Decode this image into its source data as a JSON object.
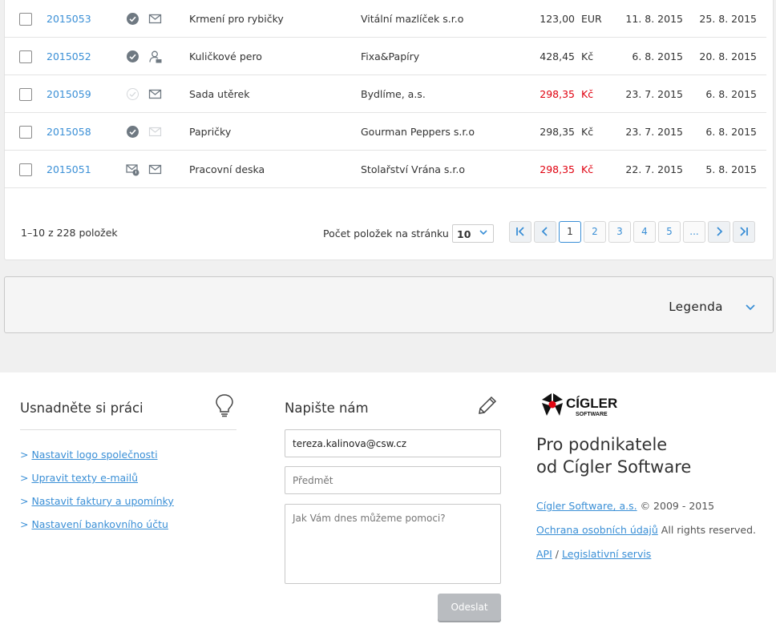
{
  "invoices": [
    {
      "number": "2015053",
      "status": "paid",
      "delivery": "email",
      "item": "Krmení pro rybičky",
      "company": "Vitální mazlíček s.r.o",
      "amount": "123,00",
      "currency": "EUR",
      "overdue": false,
      "issued": "11. 8. 2015",
      "due": "25. 8. 2015"
    },
    {
      "number": "2015052",
      "status": "paid",
      "delivery": "person",
      "item": "Kuličkové pero",
      "company": "Fixa&Papíry",
      "amount": "428,45",
      "currency": "Kč",
      "overdue": false,
      "issued": "6. 8. 2015",
      "due": "20. 8. 2015"
    },
    {
      "number": "2015059",
      "status": "unpaid",
      "delivery": "email",
      "item": "Sada utěrek",
      "company": "Bydlíme, a.s.",
      "amount": "298,35",
      "currency": "Kč",
      "overdue": true,
      "issued": "23. 7. 2015",
      "due": "6. 8. 2015"
    },
    {
      "number": "2015058",
      "status": "paid",
      "delivery": "email-pending",
      "item": "Papričky",
      "company": "Gourman Peppers s.r.o",
      "amount": "298,35",
      "currency": "Kč",
      "overdue": false,
      "issued": "23. 7. 2015",
      "due": "6. 8. 2015"
    },
    {
      "number": "2015051",
      "status": "reminder",
      "delivery": "email",
      "item": "Pracovní deska",
      "company": "Stolařství Vrána s.r.o",
      "amount": "298,35",
      "currency": "Kč",
      "overdue": true,
      "issued": "22. 7. 2015",
      "due": "5. 8. 2015"
    }
  ],
  "pagination": {
    "info": "1–10 z 228 položek",
    "per_page_label": "Počet položek na stránku",
    "per_page_value": "10",
    "pages": [
      "1",
      "2",
      "3",
      "4",
      "5",
      "..."
    ],
    "current_page": "1"
  },
  "legend": {
    "label": "Legenda"
  },
  "footer": {
    "help": {
      "title": "Usnadněte si práci",
      "links": [
        "Nastavit logo společnosti",
        "Upravit texty e-mailů",
        "Nastavit faktury a upomínky",
        "Nastavení bankovního účtu"
      ]
    },
    "contact": {
      "title": "Napište nám",
      "email_value": "tereza.kalinova@csw.cz",
      "subject_placeholder": "Předmět",
      "message_placeholder": "Jak Vám dnes můžeme pomoci?",
      "send_label": "Odeslat"
    },
    "brand": {
      "logo_text": "CÍGLER",
      "logo_sub": "SOFTWARE",
      "claim_line1": "Pro podnikatele",
      "claim_line2": "od Cígler Software",
      "company_link": "Cígler Software, a.s.",
      "copyright": "© 2009 - 2015",
      "privacy_link": "Ochrana osobních údajů",
      "rights": "All rights reserved.",
      "api_link": "API",
      "separator": "/",
      "legal_link": "Legislativní servis"
    }
  },
  "colors": {
    "link": "#3a8fd6",
    "overdue": "#e0000f",
    "status_icon": "#6f7982"
  }
}
